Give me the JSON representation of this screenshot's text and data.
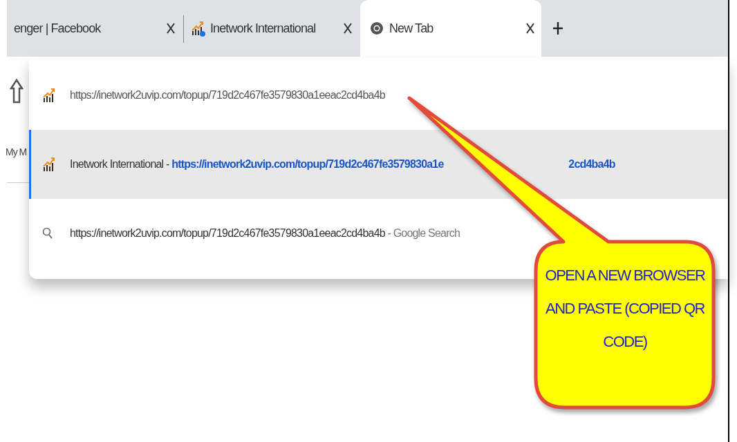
{
  "tabs": [
    {
      "title": "enger | Facebook",
      "selected": false
    },
    {
      "title": "Inetwork International",
      "badge": true,
      "selected": false
    },
    {
      "title": "New Tab",
      "selected": true
    }
  ],
  "page_behind": {
    "shortcut_label": "My M"
  },
  "suggestions": [
    {
      "kind": "url",
      "text": "https://inetwork2uvip.com/topup/719d2c467fe3579830a1eeac2cd4ba4b",
      "selected": false
    },
    {
      "kind": "title_url",
      "title": "Inetwork International - ",
      "url_parts": [
        "https://inetwork2uvip.com/topup/719d2c467fe3579830a1e",
        "2cd4ba4b"
      ],
      "selected": true
    },
    {
      "kind": "search",
      "query": "https://inetwork2uvip.com/topup/719d2c467fe3579830a1eeac2cd4ba4b",
      "suffix": " - Google Search",
      "selected": false
    }
  ],
  "callout": {
    "text": "OPEN A NEW BROWSER AND PASTE (COPIED QR CODE)"
  }
}
